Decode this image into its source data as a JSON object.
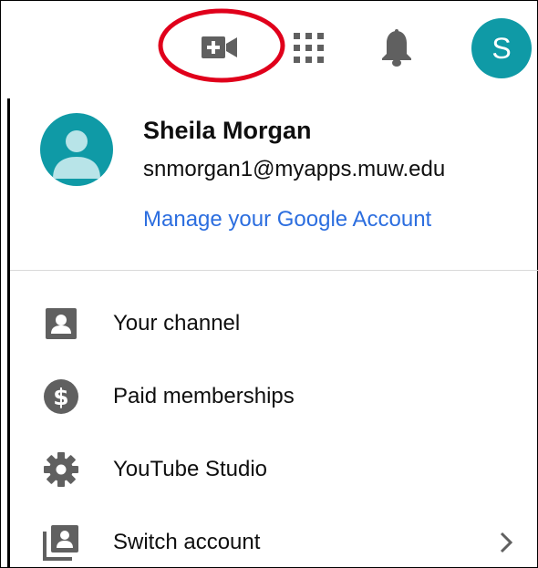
{
  "header": {
    "icons": [
      "video-camera-plus-icon",
      "apps-grid-icon",
      "notification-bell-icon"
    ],
    "avatar_initial": "S"
  },
  "profile": {
    "name": "Sheila Morgan",
    "email": "snmorgan1@myapps.muw.edu",
    "manage_label": "Manage your Google Account"
  },
  "menu": {
    "items": [
      {
        "label": "Your channel",
        "icon": "person-box-icon"
      },
      {
        "label": "Paid memberships",
        "icon": "dollar-coin-icon"
      },
      {
        "label": "YouTube Studio",
        "icon": "gear-icon"
      },
      {
        "label": "Switch account",
        "icon": "switch-account-icon",
        "has_chevron": true
      }
    ]
  },
  "colors": {
    "avatar_bg": "#0f9aa6",
    "link": "#2c6edf",
    "icon": "#606060",
    "annotation": "#e0001b"
  }
}
